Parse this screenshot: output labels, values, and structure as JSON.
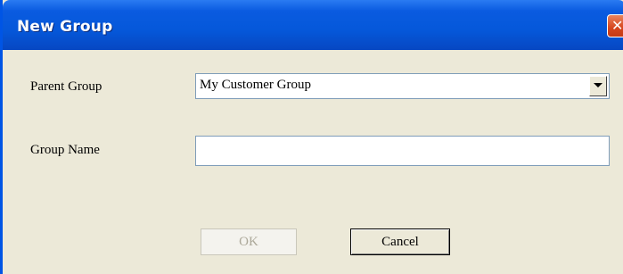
{
  "window": {
    "title": "New Group",
    "close_glyph": "✕"
  },
  "form": {
    "parent_group_label": "Parent Group",
    "parent_group_value": "My Customer Group",
    "group_name_label": "Group Name",
    "group_name_value": ""
  },
  "buttons": {
    "ok_label": "OK",
    "ok_enabled": false,
    "cancel_label": "Cancel"
  },
  "icons": {
    "close": "close-icon",
    "dropdown": "chevron-down-icon"
  },
  "colors": {
    "titlebar": "#0558DA",
    "dialog_background": "#ECE9D8",
    "close_button": "#D6461E",
    "field_border": "#7F9DB9",
    "disabled_text": "#ACA899"
  }
}
